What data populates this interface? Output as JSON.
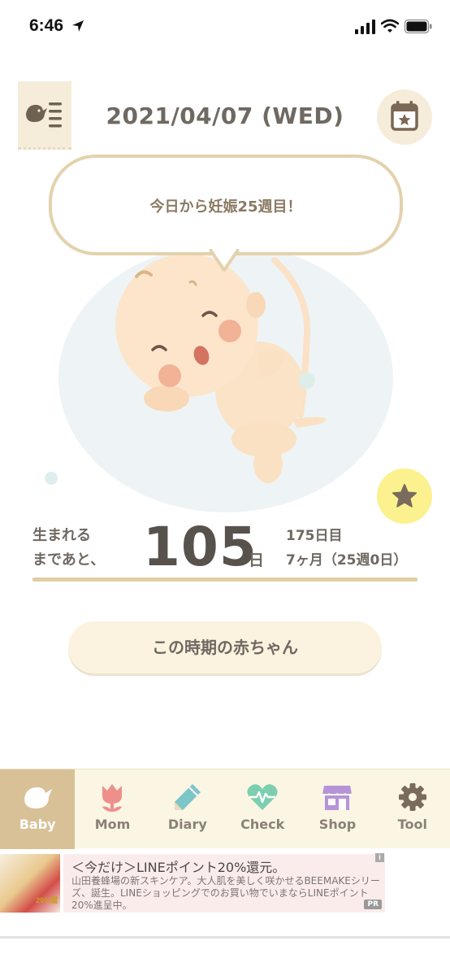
{
  "status_bar": {
    "time": "6:46",
    "icons": [
      "location-arrow-icon",
      "signal-icon",
      "wifi-icon",
      "battery-icon"
    ]
  },
  "header": {
    "date": "2021/04/07 (WED)",
    "menu_icon": "baby-menu-icon",
    "calendar_icon": "calendar-star-icon"
  },
  "bubble": {
    "message": "今日から妊娠25週目！"
  },
  "countdown": {
    "label_line1": "生まれる",
    "label_line2": "まであと、",
    "days_left": "105",
    "unit": "日",
    "day_count": "175日目",
    "month_week": "7ヶ月（25週0日）"
  },
  "main_button": {
    "label": "この時期の赤ちゃん"
  },
  "tabs": [
    {
      "label": "Baby",
      "icon": "bird-icon",
      "active": true
    },
    {
      "label": "Mom",
      "icon": "tulip-icon",
      "active": false
    },
    {
      "label": "Diary",
      "icon": "pencil-icon",
      "active": false
    },
    {
      "label": "Check",
      "icon": "heart-pulse-icon",
      "active": false
    },
    {
      "label": "Shop",
      "icon": "shop-icon",
      "active": false
    },
    {
      "label": "Tool",
      "icon": "gear-icon",
      "active": false
    }
  ],
  "ad": {
    "title": "＜今だけ＞LINEポイント20%還元。",
    "description": "山田養蜂場の新スキンケア。大人肌を美しく咲かせるBEEMAKEシリーズ、誕生。LINEショッピングでのお買い物でいまならLINEポイント20%進呈中。",
    "badge": "PR",
    "info": "i",
    "thumb_text": "20%還"
  },
  "colors": {
    "accent": "#d8c197",
    "bubble_border": "#e3d2ad",
    "star_button": "#fbf18f",
    "tab_bar": "#fbf5e3"
  }
}
